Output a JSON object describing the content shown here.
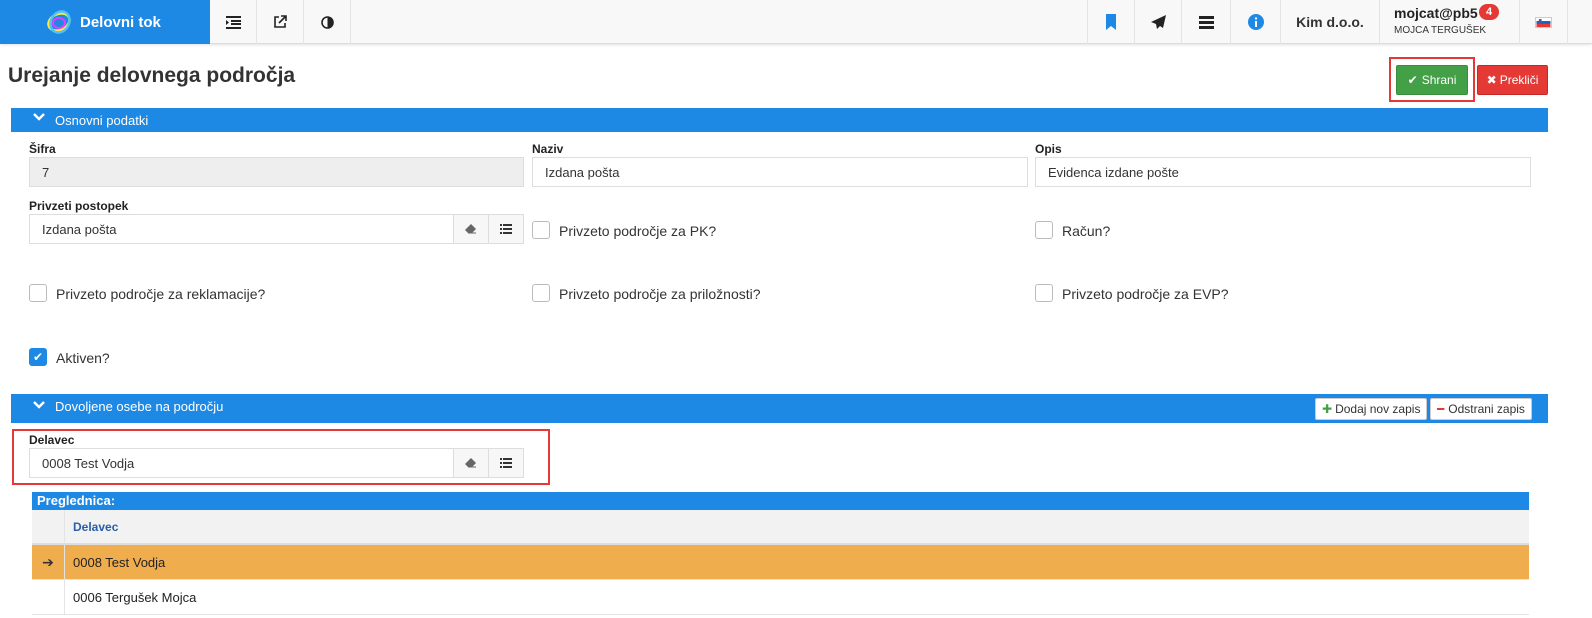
{
  "app": {
    "brand": "Delovni tok"
  },
  "topbar": {
    "company": "Kim d.o.o.",
    "user_name": "mojcat@pb5",
    "user_badge": "4",
    "user_full": "MOJCA TERGUŠEK"
  },
  "page": {
    "title": "Urejanje delovnega področja"
  },
  "actions": {
    "save": "Shrani",
    "cancel": "Prekliči"
  },
  "section1": {
    "title": "Osnovni podatki",
    "sifra_label": "Šifra",
    "sifra_value": "7",
    "naziv_label": "Naziv",
    "naziv_value": "Izdana pošta",
    "opis_label": "Opis",
    "opis_value": "Evidenca izdane pošte",
    "postopek_label": "Privzeti postopek",
    "postopek_value": "Izdana pošta",
    "checkboxes": [
      {
        "label": "Privzeto področje za PK?",
        "checked": false
      },
      {
        "label": "Račun?",
        "checked": false
      },
      {
        "label": "Privzeto področje za reklamacije?",
        "checked": false
      },
      {
        "label": "Privzeto področje za priložnosti?",
        "checked": false
      },
      {
        "label": "Privzeto področje za EVP?",
        "checked": false
      },
      {
        "label": "Aktiven?",
        "checked": true
      }
    ]
  },
  "section2": {
    "title": "Dovoljene osebe na področju",
    "add_label": "Dodaj nov zapis",
    "remove_label": "Odstrani zapis",
    "delavec_label": "Delavec",
    "delavec_value": "0008 Test Vodja",
    "grid_title": "Preglednica:",
    "grid_column": "Delavec",
    "rows": [
      "0008 Test Vodja",
      "0006 Terguš‌ek Mojca"
    ]
  },
  "colors": {
    "primary": "#1e88e5",
    "success": "#43a047",
    "danger": "#e53935",
    "highlight": "#f0ad4e"
  }
}
